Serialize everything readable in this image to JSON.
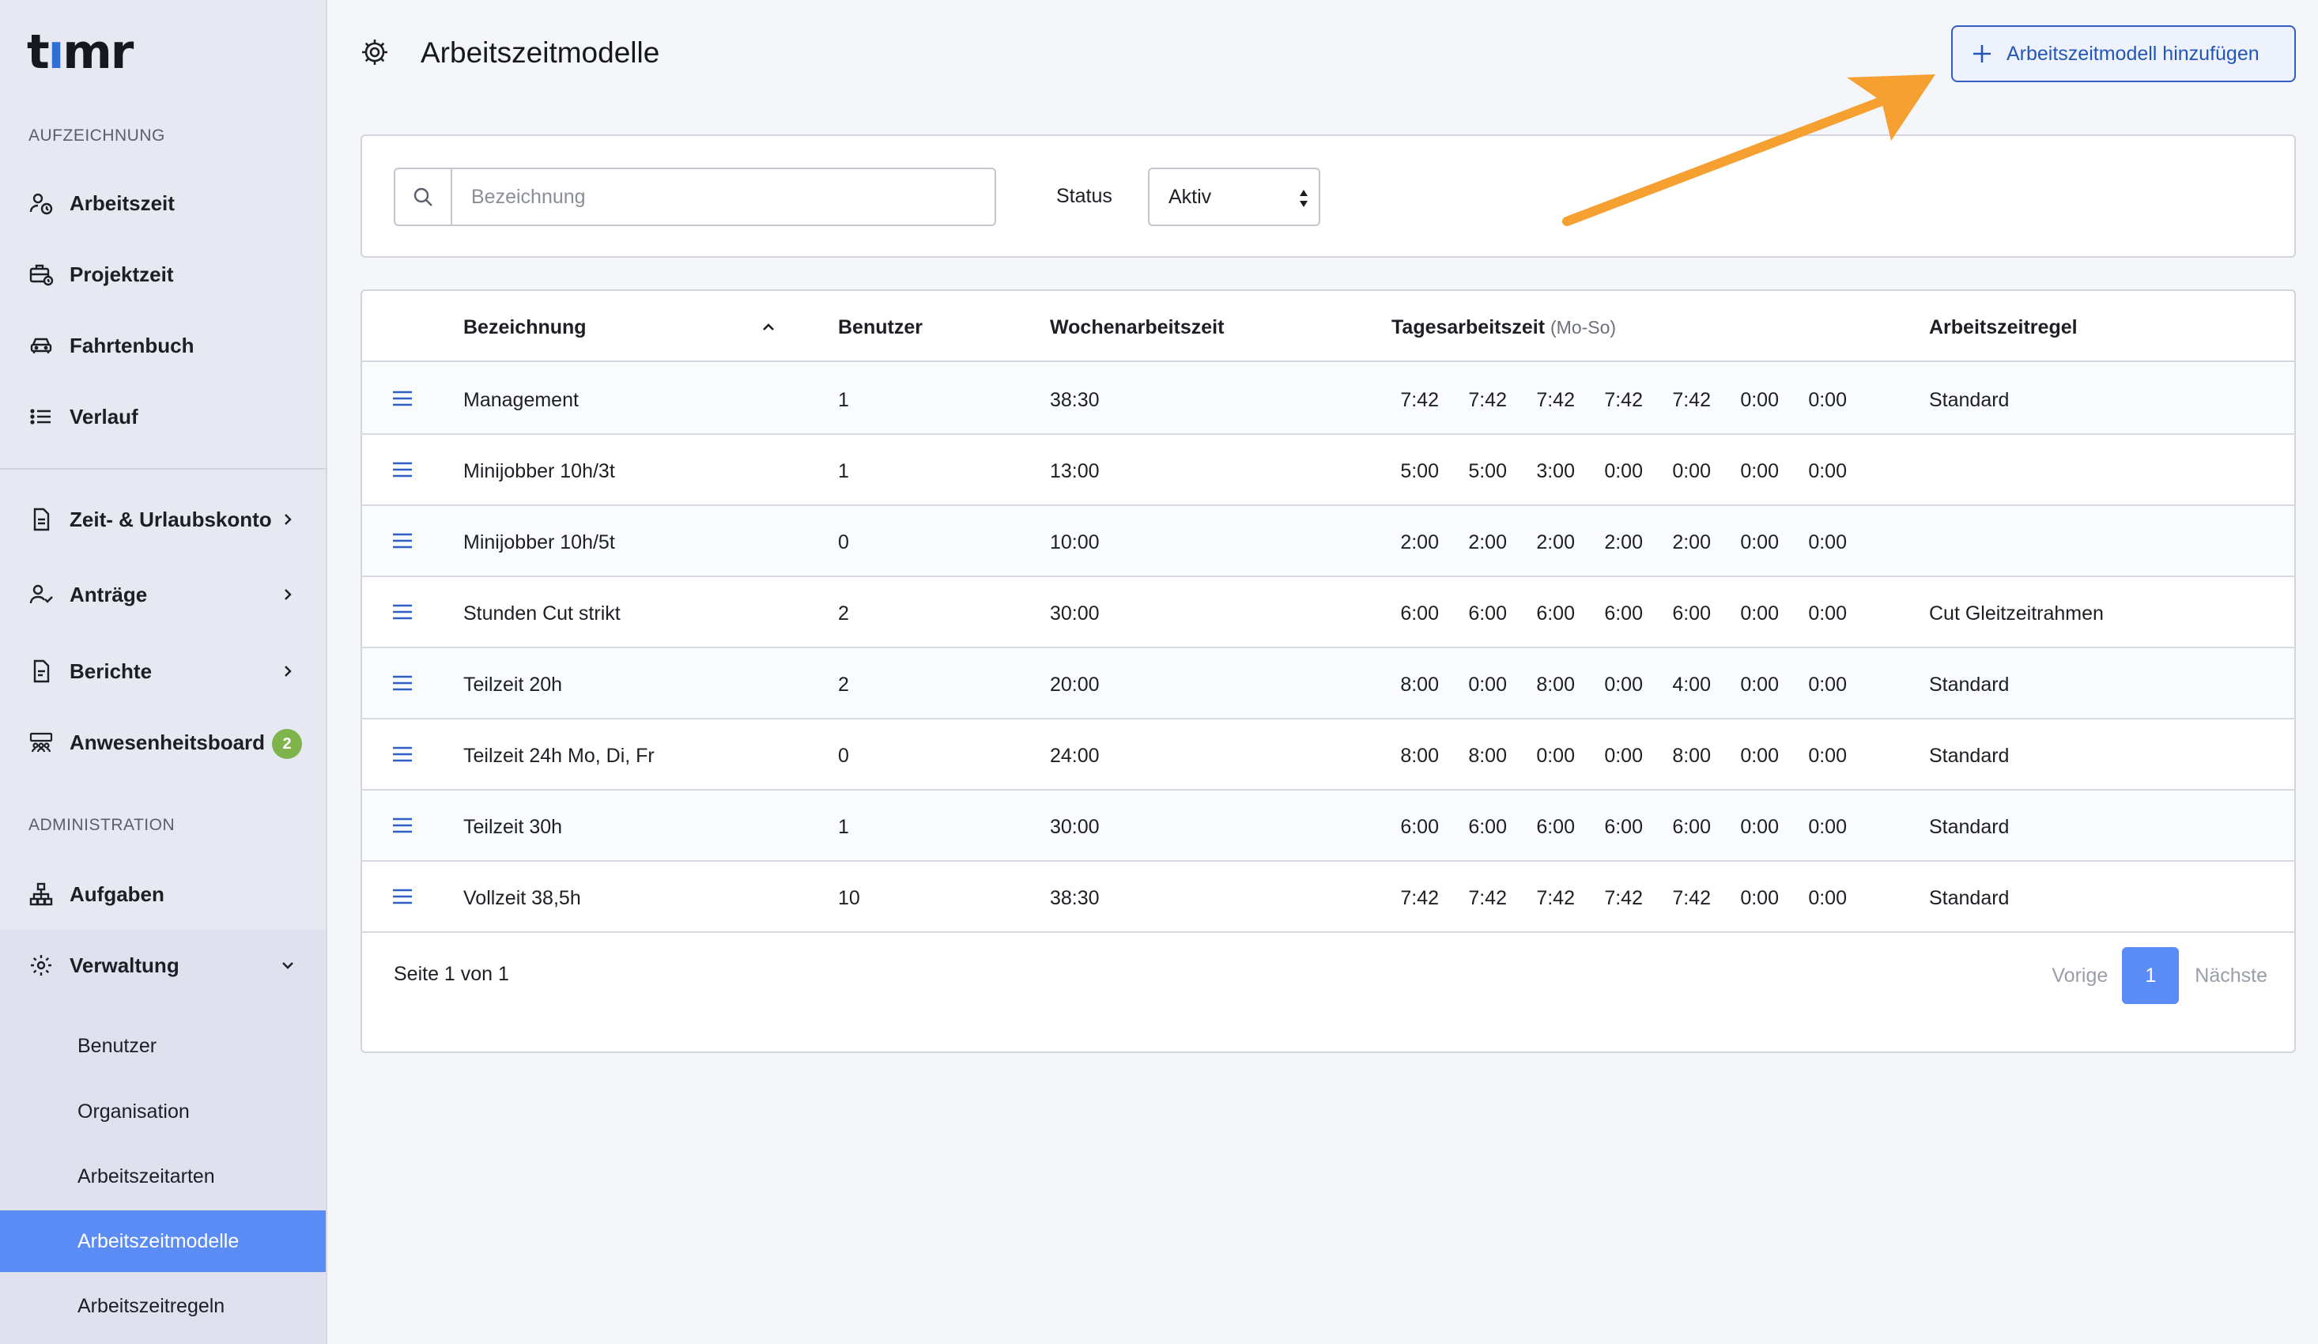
{
  "app": {
    "logo_text_a": "t",
    "logo_text_dot": "ı",
    "logo_text_b": "mr"
  },
  "sidebar": {
    "section_recording": "AUFZEICHNUNG",
    "recording_items": [
      {
        "label": "Arbeitszeit",
        "icon": "user-clock-icon"
      },
      {
        "label": "Projektzeit",
        "icon": "briefcase-clock-icon"
      },
      {
        "label": "Fahrtenbuch",
        "icon": "car-icon"
      },
      {
        "label": "Verlauf",
        "icon": "list-icon"
      }
    ],
    "account_items": [
      {
        "label": "Zeit- & Urlaubskonto",
        "icon": "document-icon"
      },
      {
        "label": "Anträge",
        "icon": "user-check-icon"
      },
      {
        "label": "Berichte",
        "icon": "report-icon"
      },
      {
        "label": "Anwesenheitsboard",
        "icon": "people-board-icon",
        "badge": "2"
      }
    ],
    "section_admin": "ADMINISTRATION",
    "admin_items": [
      {
        "label": "Aufgaben",
        "icon": "hierarchy-icon"
      },
      {
        "label": "Verwaltung",
        "icon": "gear-icon"
      }
    ],
    "verwaltung_sub": [
      {
        "label": "Benutzer"
      },
      {
        "label": "Organisation"
      },
      {
        "label": "Arbeitszeitarten"
      },
      {
        "label": "Arbeitszeitmodelle",
        "active": true
      },
      {
        "label": "Arbeitszeitregeln"
      }
    ],
    "colors": {
      "active_bg": "#5b8cf5",
      "badge_bg": "#7fb34b"
    }
  },
  "header": {
    "title": "Arbeitszeitmodelle",
    "add_button_label": "Arbeitszeitmodell hinzufügen"
  },
  "filter": {
    "search_placeholder": "Bezeichnung",
    "search_value": "",
    "status_label": "Status",
    "status_value": "Aktiv"
  },
  "table": {
    "columns": {
      "name": "Bezeichnung",
      "users": "Benutzer",
      "weekly": "Wochenarbeitszeit",
      "daily": "Tagesarbeitszeit",
      "daily_sub": "(Mo-So)",
      "rule": "Arbeitszeitregel"
    },
    "rows": [
      {
        "name": "Management",
        "users": "1",
        "weekly": "38:30",
        "days": [
          "7:42",
          "7:42",
          "7:42",
          "7:42",
          "7:42",
          "0:00",
          "0:00"
        ],
        "rule": "Standard"
      },
      {
        "name": "Minijobber 10h/3t",
        "users": "1",
        "weekly": "13:00",
        "days": [
          "5:00",
          "5:00",
          "3:00",
          "0:00",
          "0:00",
          "0:00",
          "0:00"
        ],
        "rule": ""
      },
      {
        "name": "Minijobber 10h/5t",
        "users": "0",
        "weekly": "10:00",
        "days": [
          "2:00",
          "2:00",
          "2:00",
          "2:00",
          "2:00",
          "0:00",
          "0:00"
        ],
        "rule": ""
      },
      {
        "name": "Stunden Cut strikt",
        "users": "2",
        "weekly": "30:00",
        "days": [
          "6:00",
          "6:00",
          "6:00",
          "6:00",
          "6:00",
          "0:00",
          "0:00"
        ],
        "rule": "Cut Gleitzeitrahmen"
      },
      {
        "name": "Teilzeit 20h",
        "users": "2",
        "weekly": "20:00",
        "days": [
          "8:00",
          "0:00",
          "8:00",
          "0:00",
          "4:00",
          "0:00",
          "0:00"
        ],
        "rule": "Standard"
      },
      {
        "name": "Teilzeit 24h Mo, Di, Fr",
        "users": "0",
        "weekly": "24:00",
        "days": [
          "8:00",
          "8:00",
          "0:00",
          "0:00",
          "8:00",
          "0:00",
          "0:00"
        ],
        "rule": "Standard"
      },
      {
        "name": "Teilzeit 30h",
        "users": "1",
        "weekly": "30:00",
        "days": [
          "6:00",
          "6:00",
          "6:00",
          "6:00",
          "6:00",
          "0:00",
          "0:00"
        ],
        "rule": "Standard"
      },
      {
        "name": "Vollzeit 38,5h",
        "users": "10",
        "weekly": "38:30",
        "days": [
          "7:42",
          "7:42",
          "7:42",
          "7:42",
          "7:42",
          "0:00",
          "0:00"
        ],
        "rule": "Standard"
      }
    ]
  },
  "pagination": {
    "page_info": "Seite 1 von 1",
    "prev": "Vorige",
    "current": "1",
    "next": "Nächste"
  },
  "annotation": {
    "arrow_color": "#f5a030"
  }
}
